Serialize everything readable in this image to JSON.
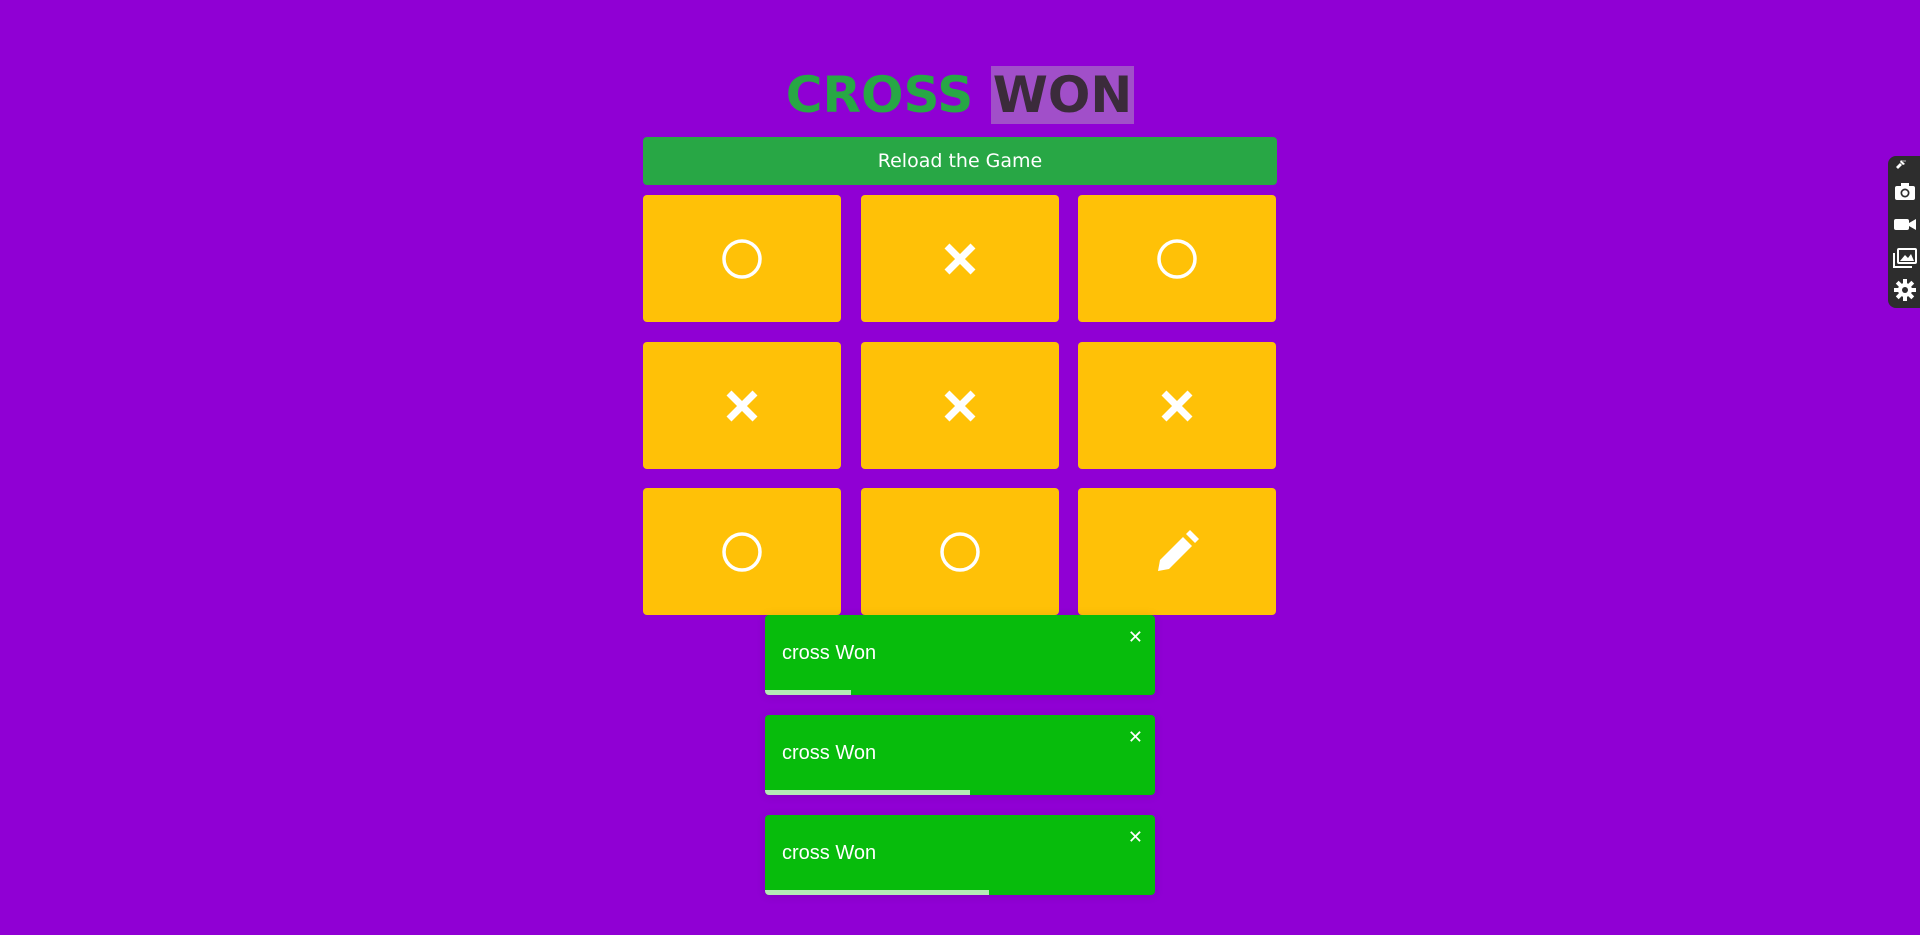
{
  "header": {
    "word1": "CROSS",
    "word2": "WON"
  },
  "reload_button": {
    "label": "Reload the Game"
  },
  "board": {
    "cells": [
      "circle",
      "cross",
      "circle",
      "cross",
      "cross",
      "cross",
      "circle",
      "circle",
      "pencil"
    ]
  },
  "toasts": [
    {
      "message": "cross Won",
      "close": "✕",
      "progress": 0.22
    },
    {
      "message": "cross Won",
      "close": "✕",
      "progress": 0.525
    },
    {
      "message": "cross Won",
      "close": "✕",
      "progress": 0.575
    }
  ],
  "extension_toolbar": {
    "buttons": [
      "camera-icon",
      "video-camera-icon",
      "gallery-icon",
      "gear-icon"
    ]
  },
  "colors": {
    "background": "#9000d4",
    "cell": "#ffc107",
    "reload": "#28a745",
    "toast": "#07bc0c",
    "title_primary": "#28a745"
  }
}
